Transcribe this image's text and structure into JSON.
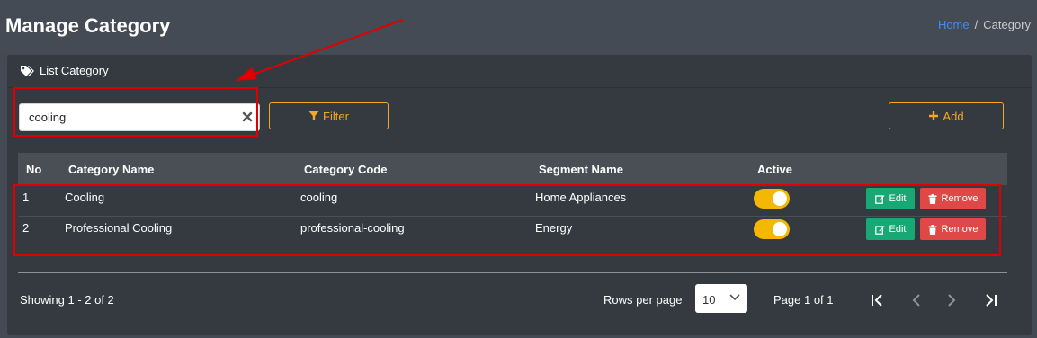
{
  "header": {
    "title": "Manage Category",
    "breadcrumb": {
      "home": "Home",
      "separator": "/",
      "current": "Category"
    }
  },
  "card": {
    "title": "List Category",
    "title_icon": "tags-icon"
  },
  "search": {
    "value": "cooling",
    "placeholder": ""
  },
  "toolbar": {
    "filter_label": "Filter",
    "add_label": "Add"
  },
  "table": {
    "columns": [
      "No",
      "Category Name",
      "Category Code",
      "Segment Name",
      "Active"
    ],
    "rows": [
      {
        "no": "1",
        "name": "Cooling",
        "code": "cooling",
        "segment": "Home Appliances",
        "active": true
      },
      {
        "no": "2",
        "name": "Professional Cooling",
        "code": "professional-cooling",
        "segment": "Energy",
        "active": true
      }
    ],
    "edit_label": "Edit",
    "remove_label": "Remove"
  },
  "footer": {
    "showing": "Showing 1 - 2 of 2",
    "rows_per_page_label": "Rows per page",
    "rows_per_page_value": "10",
    "page_info": "Page 1 of 1"
  },
  "colors": {
    "accent": "#f5a623",
    "edit": "#17a876",
    "remove": "#e04848",
    "toggle_on": "#f5b800",
    "annotation": "#e00000",
    "link": "#3d8ef0"
  }
}
